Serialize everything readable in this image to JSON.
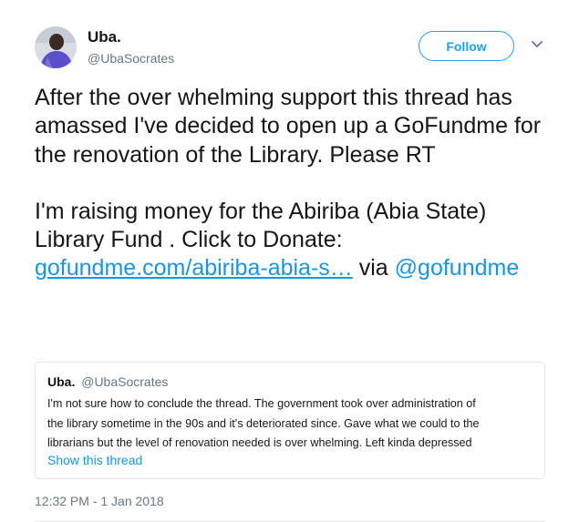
{
  "author": {
    "name": "Uba.",
    "handle": "@UbaSocrates"
  },
  "follow_label": "Follow",
  "tweet": {
    "line1": "After the over whelming support this thread has amassed I've decided to open up a GoFundme for the renovation of the Library. Please RT",
    "line2": "I'm raising money for the Abiriba (Abia State) Library Fund . Click to Donate:",
    "link_text": "gofundme.com/abiriba-abia-s…",
    "via_text": "via",
    "mention": "@gofundme"
  },
  "quoted": {
    "name": "Uba.",
    "handle": "@UbaSocrates",
    "lines": [
      "I'm not sure how to conclude the thread. The government took over administration of",
      "the library sometime in the 90s and it's deteriorated since. Gave what we could to the",
      "librarians but the level of renovation needed is over whelming. Left kinda depressed"
    ],
    "show_thread": "Show this thread"
  },
  "timestamp": "12:32 PM - 1 Jan 2018",
  "colors": {
    "accent": "#1da1f2",
    "link": "#1b95e0",
    "muted": "#657786",
    "border": "#e1e8ed"
  }
}
